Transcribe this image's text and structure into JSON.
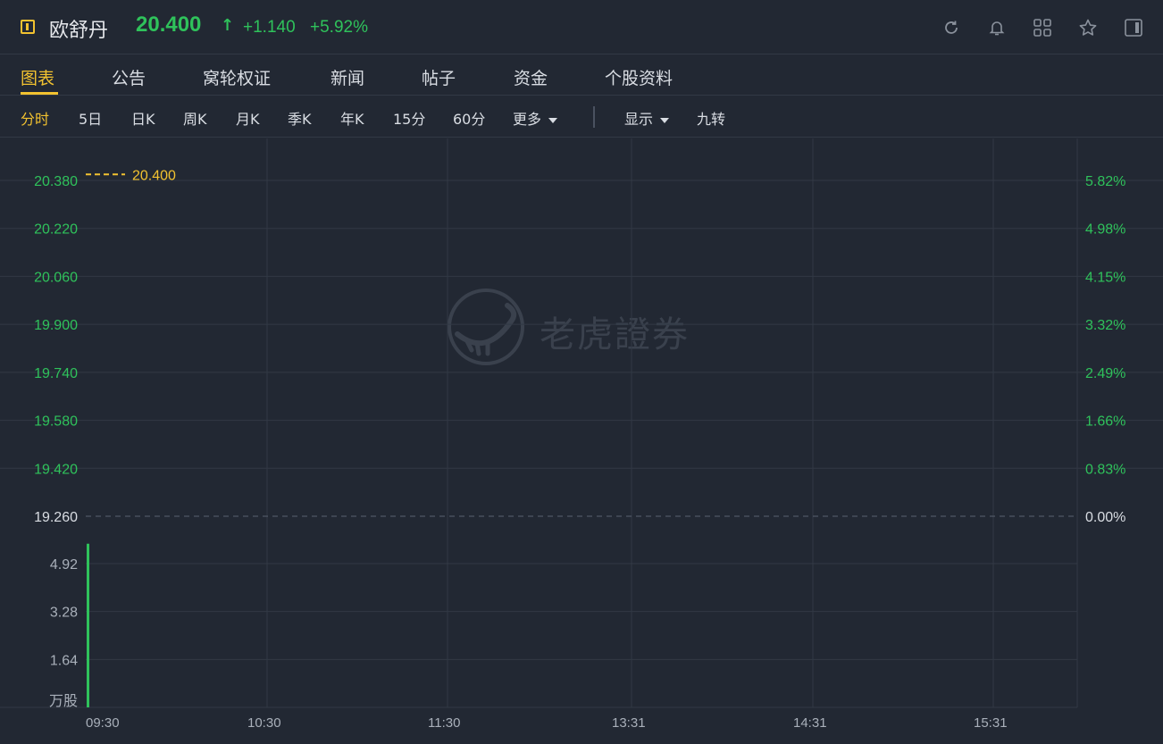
{
  "header": {
    "stock_name": "欧舒丹",
    "price": "20.400",
    "arrow": "↑",
    "change": "+1.140",
    "change_pct": "+5.92%",
    "icons": [
      "refresh-icon",
      "bell-icon",
      "grid-icon",
      "star-icon",
      "panel-icon"
    ]
  },
  "tabs": [
    "图表",
    "公告",
    "窝轮权证",
    "新闻",
    "帖子",
    "资金",
    "个股资料"
  ],
  "subbar": {
    "periods": [
      "分时",
      "5日",
      "日K",
      "周K",
      "月K",
      "季K",
      "年K",
      "15分",
      "60分"
    ],
    "more_label": "更多",
    "display_label": "显示",
    "nine_turn_label": "九转"
  },
  "watermark": "老虎證券",
  "colors": {
    "background": "#222833",
    "grid": "#323945",
    "up_green": "#2fc25b",
    "accent_yellow": "#f2c230",
    "text": "#d9dde3"
  },
  "chart_data": {
    "type": "line",
    "price_panel": {
      "y_ticks": [
        "20.380",
        "20.220",
        "20.060",
        "19.900",
        "19.740",
        "19.580",
        "19.420",
        "19.260"
      ],
      "y_values": [
        20.38,
        20.22,
        20.06,
        19.9,
        19.74,
        19.58,
        19.42,
        19.26
      ],
      "pct_ticks": [
        "5.82%",
        "4.98%",
        "4.15%",
        "3.32%",
        "2.49%",
        "1.66%",
        "0.83%",
        "0.00%"
      ],
      "prev_close": 19.26,
      "current_price_label": "20.400",
      "current_price": 20.4
    },
    "volume_panel": {
      "y_ticks": [
        "4.92",
        "3.28",
        "1.64"
      ],
      "y_values": [
        4.92,
        3.28,
        1.64
      ],
      "unit_label": "万股",
      "bars": [
        {
          "time": "09:30",
          "value": 5.6
        }
      ]
    },
    "x_ticks": [
      "09:30",
      "10:30",
      "11:30",
      "13:31",
      "14:31",
      "15:31"
    ],
    "grid": true
  }
}
